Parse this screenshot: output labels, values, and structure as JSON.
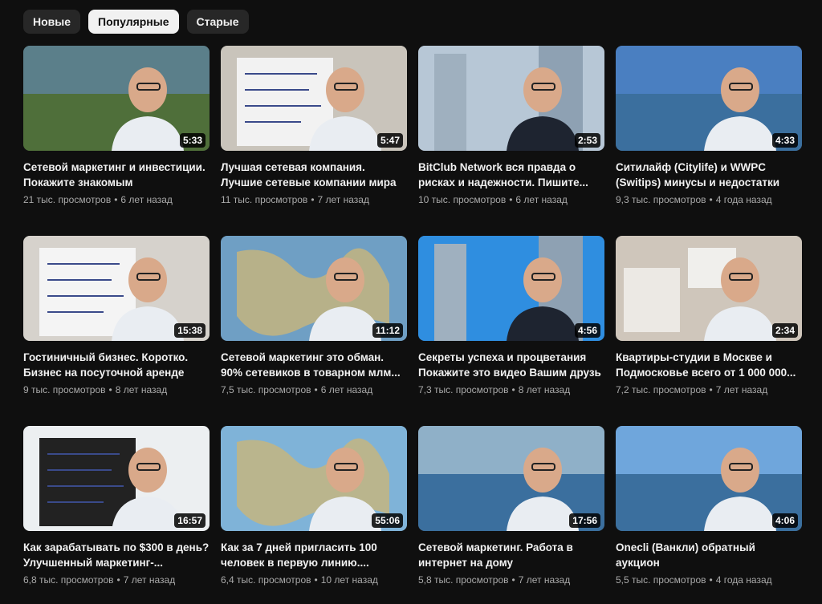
{
  "filters": [
    {
      "label": "Новые",
      "active": false
    },
    {
      "label": "Популярные",
      "active": true
    },
    {
      "label": "Старые",
      "active": false
    }
  ],
  "videos": [
    {
      "title": "Сетевой маркетинг и инвестиции. Покажите знакомым",
      "views": "21 тыс. просмотров",
      "age": "6 лет назад",
      "duration": "5:33",
      "thumb": {
        "bg": "#5b7f8a",
        "accent": "#2d6aa8",
        "type": "outdoor"
      }
    },
    {
      "title": "Лучшая сетевая компания. Лучшие сетевые компании мира",
      "views": "11 тыс. просмотров",
      "age": "7 лет назад",
      "duration": "5:47",
      "thumb": {
        "bg": "#c9c4bb",
        "accent": "#f2f2f2",
        "type": "board"
      }
    },
    {
      "title": "BitClub Network вся правда о рисках и надежности. Пишите...",
      "views": "10 тыс. просмотров",
      "age": "6 лет назад",
      "duration": "2:53",
      "thumb": {
        "bg": "#b7c7d6",
        "accent": "#1b1b1b",
        "type": "city"
      }
    },
    {
      "title": "Ситилайф (Citylife) и WWPC (Switips) минусы и недостатки",
      "views": "9,3 тыс. просмотров",
      "age": "4 года назад",
      "duration": "4:33",
      "thumb": {
        "bg": "#4a7fc1",
        "accent": "#e8e8e8",
        "type": "beach"
      }
    },
    {
      "title": "Гостиничный бизнес. Коротко. Бизнес на посуточной аренде",
      "views": "9 тыс. просмотров",
      "age": "8 лет назад",
      "duration": "15:38",
      "thumb": {
        "bg": "#d6d2cc",
        "accent": "#f4f4f4",
        "type": "board"
      }
    },
    {
      "title": "Сетевой маркетинг это обман. 90% сетевиков в товарном млм...",
      "views": "7,5 тыс. просмотров",
      "age": "6 лет назад",
      "duration": "11:12",
      "thumb": {
        "bg": "#6f9fc4",
        "accent": "#e9e4d6",
        "type": "map"
      }
    },
    {
      "title": "Секреты успеха и процветания Покажите это видео Вашим друзь",
      "views": "7,3 тыс. просмотров",
      "age": "8 лет назад",
      "duration": "4:56",
      "thumb": {
        "bg": "#2f8ee0",
        "accent": "#1e2733",
        "type": "city"
      }
    },
    {
      "title": "Квартиры-студии в Москве и Подмосковье всего от 1 000 000...",
      "views": "7,2 тыс. просмотров",
      "age": "7 лет назад",
      "duration": "2:34",
      "thumb": {
        "bg": "#cfc6bb",
        "accent": "#f5f5f5",
        "type": "room"
      }
    },
    {
      "title": "Как зарабатывать по $300 в день? Улучшенный маркетинг-...",
      "views": "6,8 тыс. просмотров",
      "age": "7 лет назад",
      "duration": "16:57",
      "thumb": {
        "bg": "#eceff1",
        "accent": "#222222",
        "type": "board"
      }
    },
    {
      "title": "Как за 7 дней пригласить 100 человек в первую линию....",
      "views": "6,4 тыс. просмотров",
      "age": "10 лет назад",
      "duration": "55:06",
      "thumb": {
        "bg": "#7fb3d8",
        "accent": "#e9d34a",
        "type": "map"
      }
    },
    {
      "title": "Сетевой маркетинг. Работа в интернет на дому",
      "views": "5,8 тыс. просмотров",
      "age": "7 лет назад",
      "duration": "17:56",
      "thumb": {
        "bg": "#8fb0c8",
        "accent": "#d6c29a",
        "type": "beach"
      }
    },
    {
      "title": "Onecli (Ванкли) обратный аукцион",
      "views": "5,5 тыс. просмотров",
      "age": "4 года назад",
      "duration": "4:06",
      "thumb": {
        "bg": "#6fa6dc",
        "accent": "#2b5d86",
        "type": "beach"
      }
    }
  ]
}
